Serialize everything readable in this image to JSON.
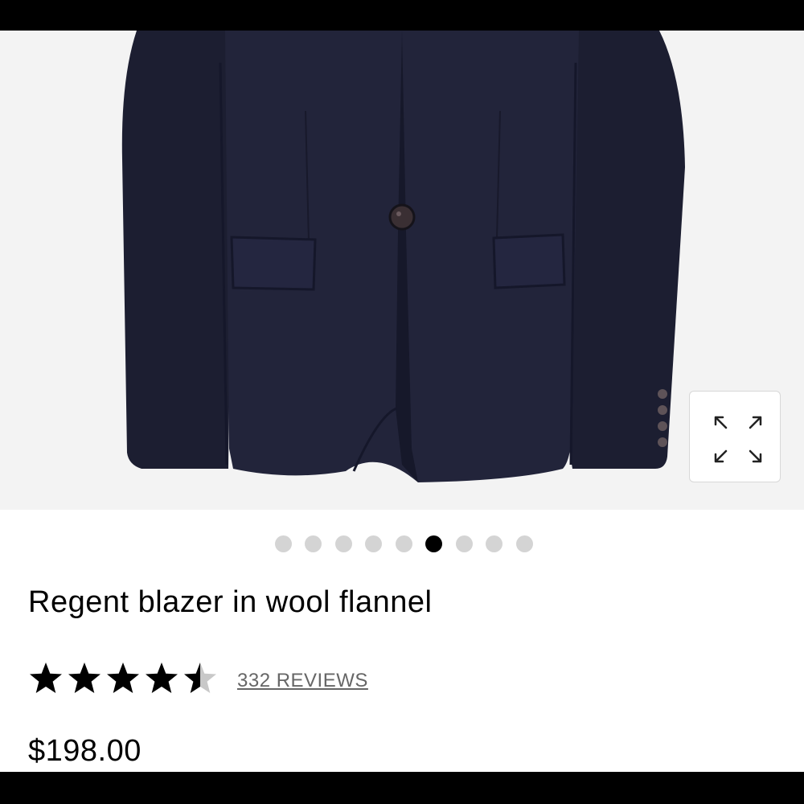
{
  "product": {
    "image_alt": "Navy wool flannel blazer",
    "title": "Regent blazer in wool flannel",
    "rating": 4.5,
    "rating_max": 5,
    "reviews_label": "332 REVIEWS",
    "price": "$198.00"
  },
  "gallery": {
    "image_count": 9,
    "active_index": 5
  },
  "icons": {
    "expand": "expand-icon",
    "star": "star-icon"
  },
  "colors": {
    "blazer": "#1d1f33",
    "star_filled": "#000000",
    "star_empty": "#c8c8c8",
    "dot_active": "#000000",
    "dot_inactive": "#d4d4d4"
  }
}
